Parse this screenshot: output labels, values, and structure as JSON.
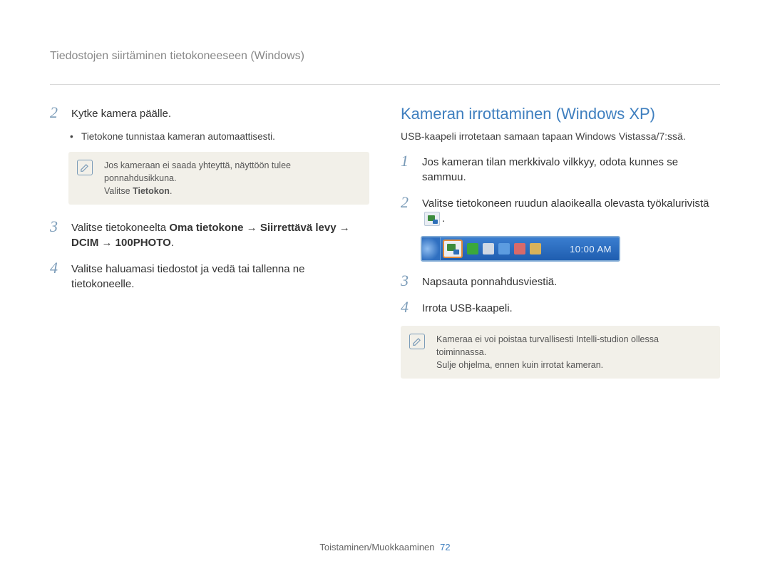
{
  "breadcrumb": "Tiedostojen siirtäminen tietokoneeseen (Windows)",
  "left": {
    "step2": {
      "num": "2",
      "text": "Kytke kamera päälle."
    },
    "bullet1": "Tietokone tunnistaa kameran automaattisesti.",
    "note1": {
      "line1": "Jos kameraan ei saada yhteyttä, näyttöön tulee ponnahdusikkuna.",
      "line2_prefix": "Valitse ",
      "line2_bold": "Tietokon",
      "line2_suffix": "."
    },
    "step3": {
      "num": "3",
      "prefix": "Valitse tietokoneelta ",
      "bold": "Oma tietokone → Siirrettävä levy → DCIM → 100PHOTO",
      "suffix": "."
    },
    "step4": {
      "num": "4",
      "text": "Valitse haluamasi tiedostot ja vedä tai tallenna ne tietokoneelle."
    }
  },
  "right": {
    "title": "Kameran irrottaminen (Windows XP)",
    "sub": "USB-kaapeli irrotetaan samaan tapaan Windows Vistassa/7:ssä.",
    "step1": {
      "num": "1",
      "text": "Jos kameran tilan merkkivalo vilkkyy, odota kunnes se sammuu."
    },
    "step2": {
      "num": "2",
      "text_before": "Valitse tietokoneen ruudun alaoikealla olevasta työkalurivistä",
      "text_after": "."
    },
    "tray_time": "10:00 AM",
    "step3": {
      "num": "3",
      "text": "Napsauta ponnahdusviestiä."
    },
    "step4": {
      "num": "4",
      "text": "Irrota USB-kaapeli."
    },
    "note2": {
      "line1": "Kameraa ei voi poistaa turvallisesti Intelli-studion ollessa toiminnassa.",
      "line2": "Sulje ohjelma, ennen kuin irrotat kameran."
    }
  },
  "footer": {
    "label": "Toistaminen/Muokkaaminen",
    "page": "72"
  }
}
